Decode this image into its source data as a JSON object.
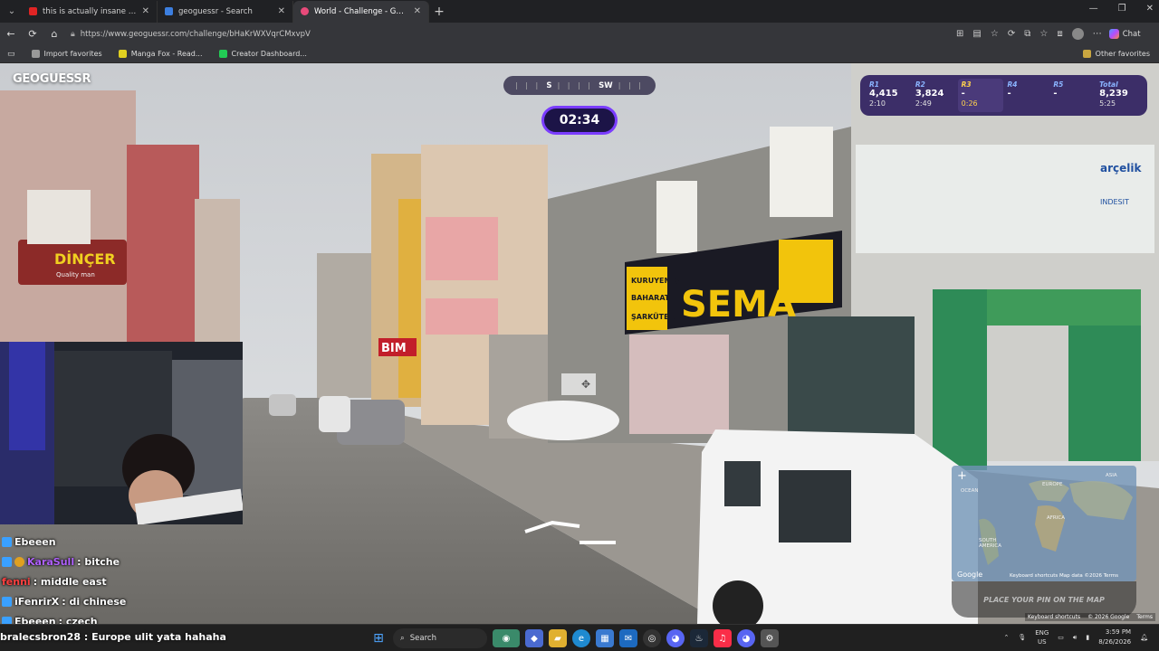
{
  "browser": {
    "tabs": [
      {
        "label": "this is actually insane 😭 - YouTube",
        "color": "#e02424",
        "active": false
      },
      {
        "label": "geoguessr - Search",
        "color": "#3c7fe0",
        "active": false
      },
      {
        "label": "World - Challenge - GeoGuessr",
        "color": "#e84a7a",
        "active": true
      }
    ],
    "url": "https://www.geoguessr.com/challenge/bHaKrWXVqrCMxvpV",
    "bookmarks": [
      {
        "label": "Import favorites",
        "color": "#999"
      },
      {
        "label": "Manga Fox - Read...",
        "color": "#e0d020"
      },
      {
        "label": "Creator Dashboard...",
        "color": "#22cc55"
      }
    ],
    "other_favorites": "Other favorites",
    "chat_label": "Chat"
  },
  "game": {
    "logo": "GEOGUESSR",
    "compass": [
      "S",
      "SW"
    ],
    "timer": "02:34",
    "rounds": [
      {
        "label": "R1",
        "score": "4,415",
        "time": "2:10",
        "state": "done"
      },
      {
        "label": "R2",
        "score": "3,824",
        "time": "2:49",
        "state": "done"
      },
      {
        "label": "R3",
        "score": "-",
        "time": "0:26",
        "state": "current"
      },
      {
        "label": "R4",
        "score": "-",
        "time": "",
        "state": "pending"
      },
      {
        "label": "R5",
        "score": "-",
        "time": "",
        "state": "pending"
      },
      {
        "label": "Total",
        "score": "8,239",
        "time": "5:25",
        "state": "total"
      }
    ],
    "minimap": {
      "labels": [
        "EUROPE",
        "ASIA",
        "AFRICA",
        "SOUTH AMERICA",
        "OCEAN"
      ],
      "footer": "Keyboard shortcuts  Map data ©2026  Terms",
      "google": "Google",
      "place_pin": "PLACE YOUR PIN ON THE MAP"
    },
    "scene_signs": {
      "sema": "SEMA",
      "kuruyemis": "KURUYEMİŞ",
      "baharat": "BAHARAT",
      "sarkuteri": "ŞARKÜTERİ",
      "bim": "BIM",
      "dincer": "DİNÇER",
      "dincer_sub": "Quality man",
      "arcelik": "arçelik",
      "indesit": "INDESIT"
    },
    "google_footer": [
      "Keyboard shortcuts",
      "© 2026 Google",
      "Terms"
    ]
  },
  "chat": [
    {
      "user": "Ebeeen",
      "msg": "",
      "color": "#ffffff"
    },
    {
      "user": "KaraSull",
      "msg": ": bitche",
      "color": "#b060ff"
    },
    {
      "user": "fenni",
      "msg": ": middle east",
      "color": "#ff4040"
    },
    {
      "user": "iFenrirX",
      "msg": ": di chinese",
      "color": "#ffffff"
    },
    {
      "user": "Ebeeen",
      "msg": ": czech",
      "color": "#ffffff"
    }
  ],
  "bottom_chat": "bralecsbron28 : Europe ulit yata hahaha",
  "taskbar": {
    "search": "Search",
    "lang": [
      "ENG",
      "US"
    ],
    "time": "3:59 PM",
    "date": "8/26/2026"
  }
}
